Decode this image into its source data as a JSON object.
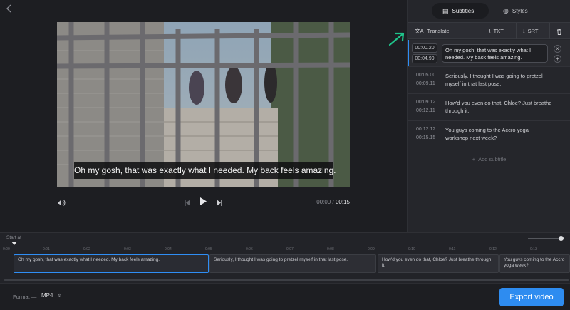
{
  "header": {
    "back_icon": "chevron-left-icon"
  },
  "video": {
    "caption": "Oh my gosh, that was exactly what I needed. My back feels amazing.",
    "current_time": "00:00",
    "separator": "/",
    "duration": "00:15"
  },
  "tabs": [
    {
      "label": "Subtitles",
      "icon": "subtitles-icon",
      "active": true
    },
    {
      "label": "Styles",
      "icon": "palette-icon",
      "active": false
    }
  ],
  "toolbar": {
    "translate_label": "Translate",
    "txt_label": "TXT",
    "srt_label": "SRT"
  },
  "subtitles": [
    {
      "start": "00:00.20",
      "end": "00:04.99",
      "text": "Oh my gosh, that was exactly what I needed. My back feels amazing.",
      "active": true
    },
    {
      "start": "00:05.00",
      "end": "00:09.11",
      "text": "Seriously, I thought I was going to pretzel myself in that last pose.",
      "active": false
    },
    {
      "start": "00:09.12",
      "end": "00:12.11",
      "text": "How'd you even do that, Chloe? Just breathe through it.",
      "active": false
    },
    {
      "start": "00:12.12",
      "end": "00:15.15",
      "text": "You guys coming to the Accro yoga workshop next week?",
      "active": false
    }
  ],
  "add_subtitle_label": "Add subtitle",
  "timeline": {
    "start_at_label": "Start at",
    "ticks": [
      "0:00",
      "0:01",
      "0:02",
      "0:03",
      "0:04",
      "0:05",
      "0:06",
      "0:07",
      "0:08",
      "0:09",
      "0:10",
      "0:11",
      "0:12",
      "0:13"
    ],
    "clips": [
      {
        "text": "Oh my gosh, that was exactly what I needed. My back feels amazing.",
        "active": true
      },
      {
        "text": "Seriously, I thought I was going to pretzel myself in that last pose.",
        "active": false
      },
      {
        "text": "How'd you even do that, Chloe? Just breathe through it.",
        "active": false
      },
      {
        "text": "You guys coming to the Accro yoga week?",
        "active": false
      }
    ]
  },
  "footer": {
    "format_label": "Format —",
    "format_value": "MP4",
    "export_label": "Export video"
  },
  "colors": {
    "accent": "#2e8cf0",
    "annotation": "#1fc38a"
  }
}
